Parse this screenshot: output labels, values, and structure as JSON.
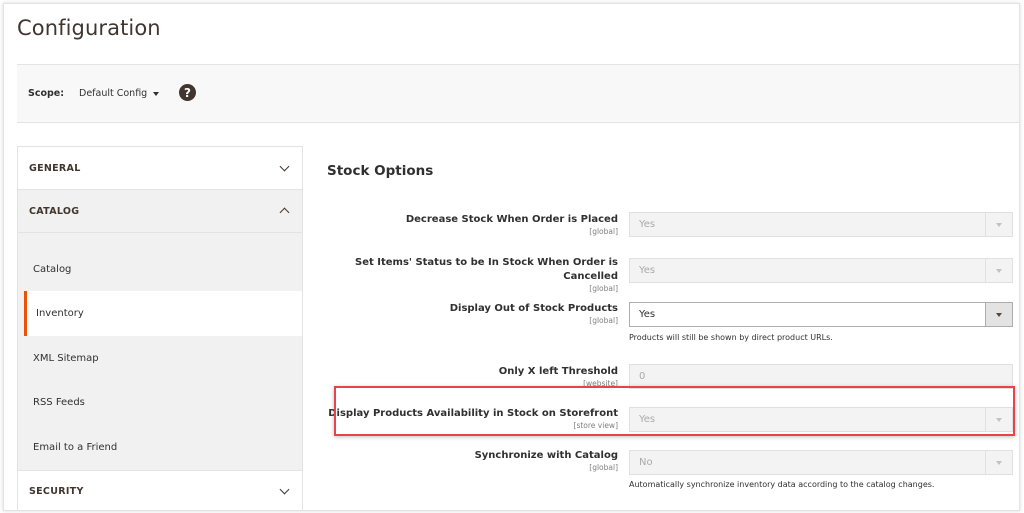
{
  "page": {
    "title": "Configuration"
  },
  "scope": {
    "label": "Scope:",
    "value": "Default Config",
    "help_icon": "question-circle-icon"
  },
  "sidebar": {
    "sections": [
      {
        "title": "GENERAL",
        "state": "collapsed"
      },
      {
        "title": "CATALOG",
        "state": "expanded",
        "items": [
          {
            "label": "Catalog",
            "active": false
          },
          {
            "label": "Inventory",
            "active": true
          },
          {
            "label": "XML Sitemap",
            "active": false
          },
          {
            "label": "RSS Feeds",
            "active": false
          },
          {
            "label": "Email to a Friend",
            "active": false
          }
        ]
      },
      {
        "title": "SECURITY",
        "state": "collapsed"
      }
    ]
  },
  "main": {
    "section_title": "Stock Options",
    "fields": [
      {
        "label": "Decrease Stock When Order is Placed",
        "scope": "[global]",
        "value": "Yes",
        "disabled": true,
        "type": "select"
      },
      {
        "label_line1": "Set Items' Status to be In Stock When Order is",
        "label_line2": "Cancelled",
        "scope": "[global]",
        "value": "Yes",
        "disabled": true,
        "type": "select"
      },
      {
        "label": "Display Out of Stock Products",
        "scope": "[global]",
        "value": "Yes",
        "disabled": false,
        "type": "select",
        "note": "Products will still be shown by direct product URLs."
      },
      {
        "label": "Only X left Threshold",
        "scope": "[website]",
        "value": "0",
        "disabled": true,
        "type": "text"
      },
      {
        "label": "Display Products Availability in Stock on Storefront",
        "scope": "[store view]",
        "value": "Yes",
        "disabled": true,
        "type": "select",
        "highlighted": true
      },
      {
        "label": "Synchronize with Catalog",
        "scope": "[global]",
        "value": "No",
        "disabled": true,
        "type": "select",
        "note": "Automatically synchronize inventory data according to the catalog changes."
      }
    ]
  },
  "colors": {
    "accent": "#eb5202",
    "highlight": "#e8424a",
    "title": "#41362f"
  }
}
